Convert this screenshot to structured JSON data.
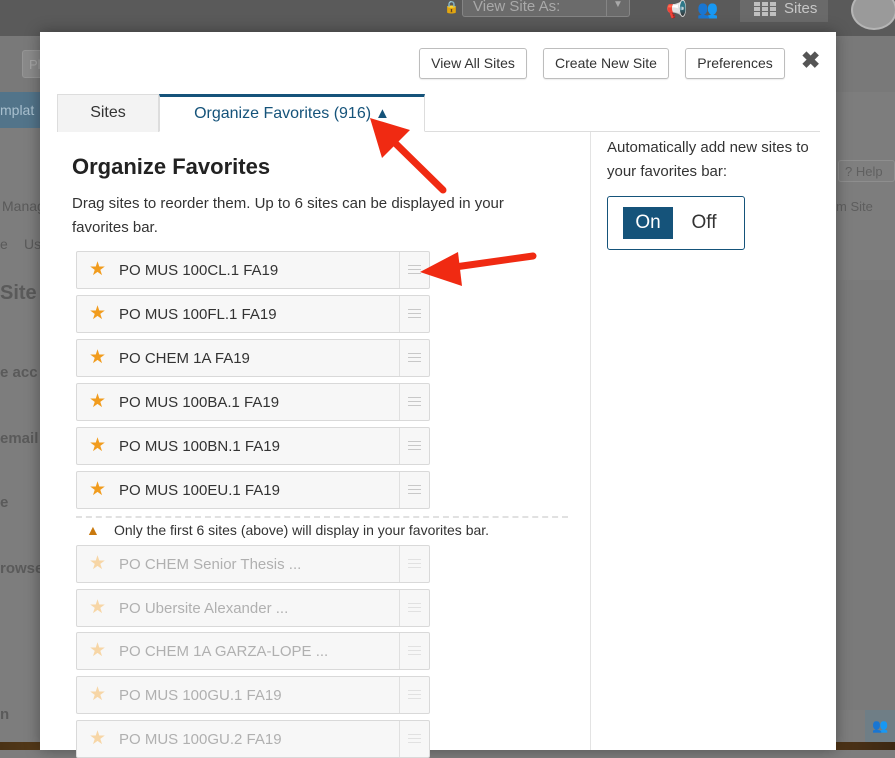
{
  "background": {
    "view_site_as_placeholder": "View Site As:",
    "sites_label": "Sites",
    "sub_pill": "Pl",
    "left_tab_fragment": "mplat",
    "help_label": "? Help",
    "left_fragments": [
      "Manag",
      "e",
      "Us",
      "Site",
      "e acc",
      "email",
      "e",
      "rowse",
      "n"
    ],
    "right_fragment": "m Site"
  },
  "header": {
    "buttons": [
      "View All Sites",
      "Create New Site",
      "Preferences"
    ],
    "close_icon": "close-icon"
  },
  "tabs": [
    {
      "label": "Sites"
    },
    {
      "label": "Organize Favorites (916)",
      "icon": "warning-icon"
    }
  ],
  "main": {
    "title": "Organize Favorites",
    "description": "Drag sites to reorder them. Up to 6 sites can be displayed in your favorites bar.",
    "favorites": [
      {
        "name": "PO MUS 100CL.1 FA19"
      },
      {
        "name": "PO MUS 100FL.1 FA19"
      },
      {
        "name": "PO CHEM 1A FA19"
      },
      {
        "name": "PO MUS 100BA.1 FA19"
      },
      {
        "name": "PO MUS 100BN.1 FA19"
      },
      {
        "name": "PO MUS 100EU.1 FA19"
      }
    ],
    "limit_notice": "Only the first 6 sites (above) will display in your favorites bar.",
    "overflow": [
      {
        "name": "PO CHEM Senior Thesis ..."
      },
      {
        "name": "PO Ubersite Alexander ..."
      },
      {
        "name": "PO CHEM 1A GARZA-LOPE ..."
      },
      {
        "name": "PO MUS 100GU.1 FA19"
      },
      {
        "name": "PO MUS 100GU.2 FA19"
      }
    ]
  },
  "sidebar": {
    "auto_add_label": "Automatically add new sites to your favorites bar:",
    "toggle": {
      "on": "On",
      "off": "Off",
      "selected": "On"
    }
  },
  "colors": {
    "accent": "#15537a",
    "star": "#f19c1e",
    "warning": "#c9790e",
    "annotation_arrow": "#f02a12"
  }
}
